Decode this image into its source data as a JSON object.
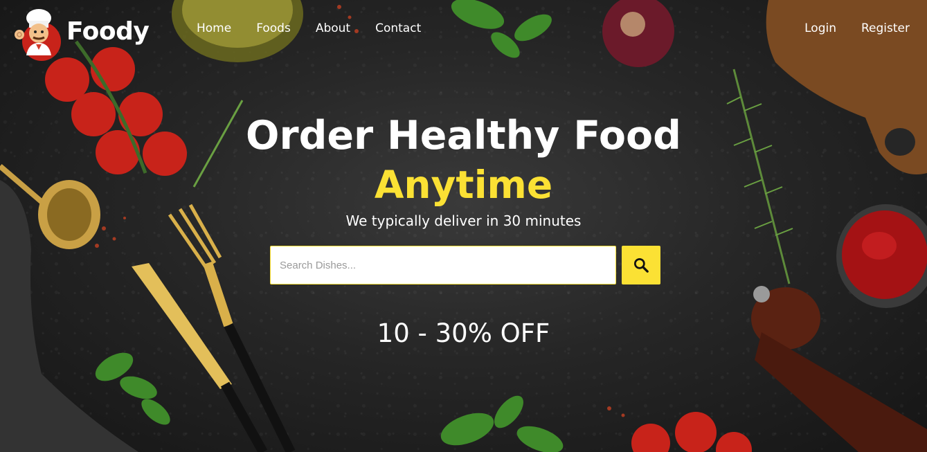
{
  "brand": {
    "name": "Foody",
    "logo_icon": "chef-icon"
  },
  "nav": {
    "links": [
      "Home",
      "Foods",
      "About",
      "Contact"
    ]
  },
  "auth": {
    "login": "Login",
    "register": "Register"
  },
  "hero": {
    "title": "Order Healthy Food",
    "accent": "Anytime",
    "subtitle": "We typically deliver in 30 minutes"
  },
  "search": {
    "placeholder": "Search Dishes...",
    "button_icon": "search-icon"
  },
  "offer": {
    "text": "10 - 30% OFF"
  },
  "colors": {
    "accent": "#fbe134",
    "text": "#ffffff",
    "background": "#262626"
  }
}
